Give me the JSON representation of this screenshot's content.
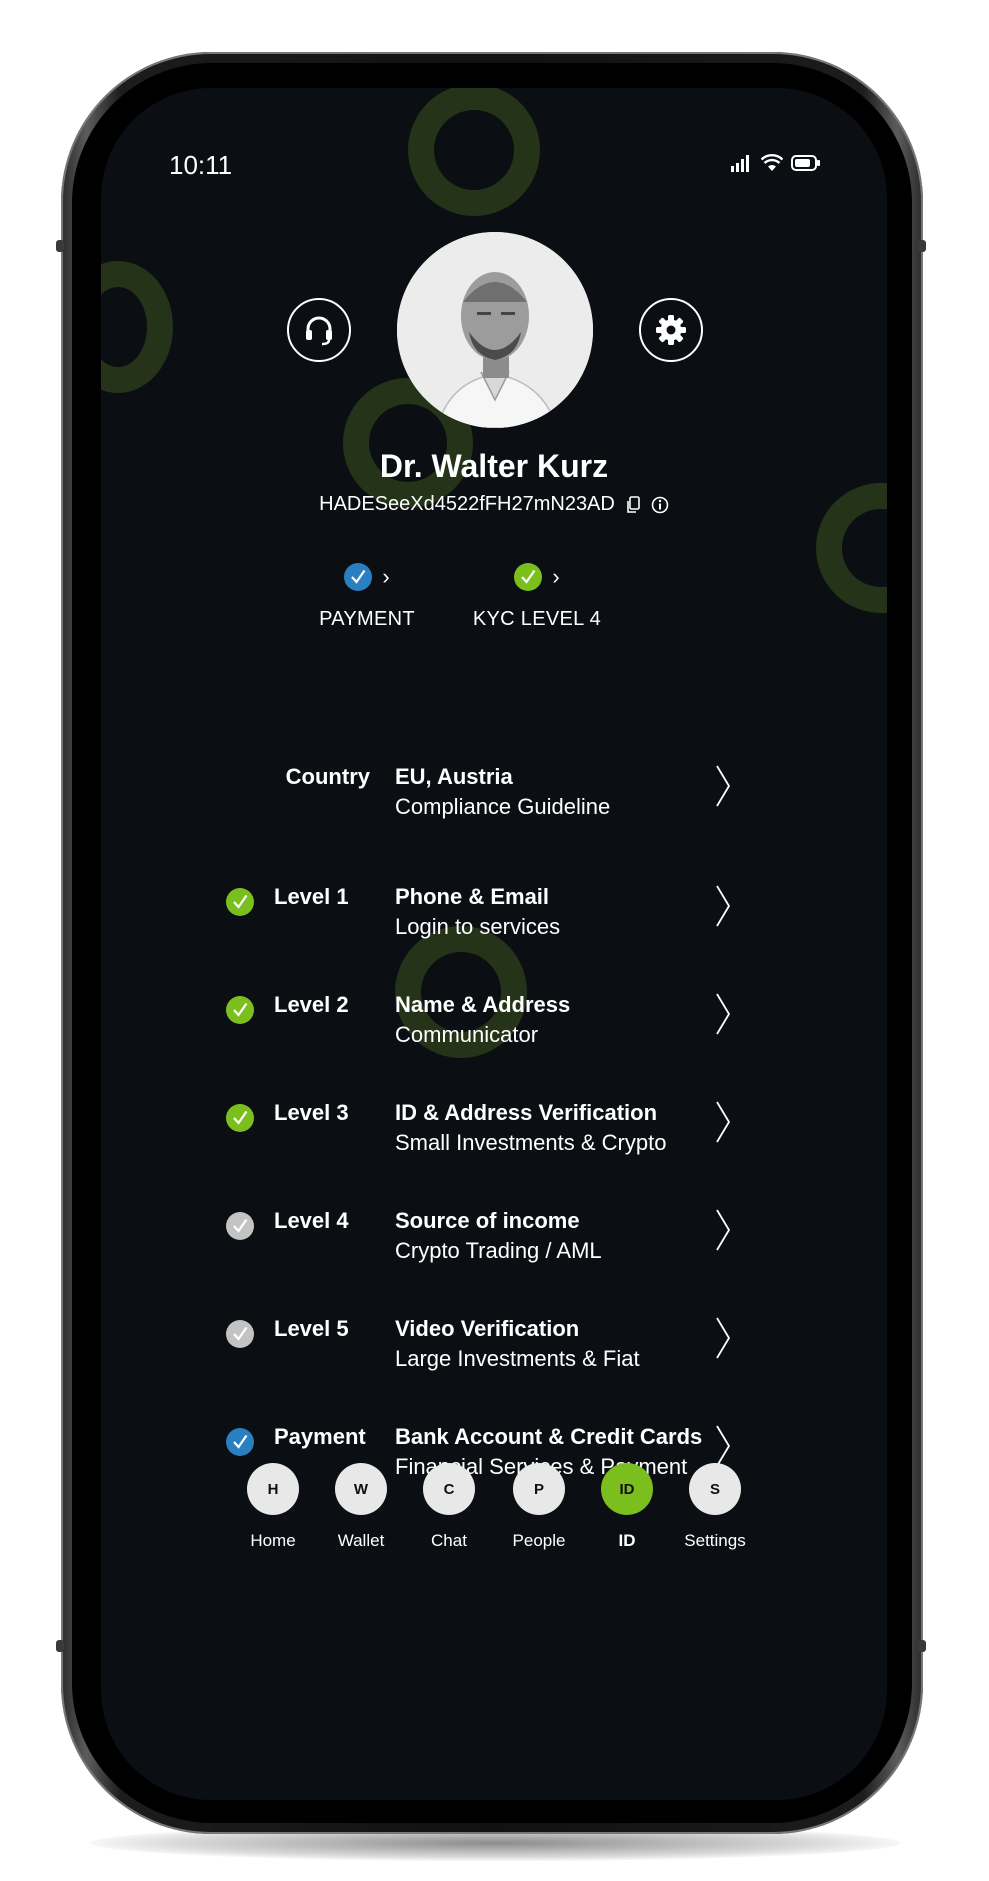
{
  "status_bar": {
    "time": "10:11",
    "icons": [
      "signal-icon",
      "wifi-icon",
      "battery-icon"
    ]
  },
  "header": {
    "support_icon": "headset-icon",
    "settings_icon": "gear-icon",
    "user_name": "Dr. Walter Kurz",
    "user_id": "HADESeeXd4522fFH27mN23AD",
    "id_icons": [
      "copy-icon",
      "info-icon"
    ]
  },
  "badges": [
    {
      "label": "PAYMENT",
      "status": "blue"
    },
    {
      "label": "KYC LEVEL 4",
      "status": "green"
    }
  ],
  "rows": [
    {
      "label": "Country",
      "title": "EU, Austria",
      "subtitle": "Compliance Guideline",
      "status": "none"
    },
    {
      "label": "Level 1",
      "title": "Phone & Email",
      "subtitle": "Login to services",
      "status": "green"
    },
    {
      "label": "Level 2",
      "title": "Name & Address",
      "subtitle": "Communicator",
      "status": "green"
    },
    {
      "label": "Level 3",
      "title": "ID & Address Verification",
      "subtitle": "Small Investments & Crypto",
      "status": "green"
    },
    {
      "label": "Level 4",
      "title": "Source of income",
      "subtitle": "Crypto Trading / AML",
      "status": "grey"
    },
    {
      "label": "Level 5",
      "title": "Video Verification",
      "subtitle": "Large Investments & Fiat",
      "status": "grey"
    },
    {
      "label": "Payment",
      "title": "Bank Account & Credit Cards",
      "subtitle": "Financial Services & Payment",
      "status": "blue"
    }
  ],
  "nav": [
    {
      "letter": "H",
      "label": "Home",
      "active": false
    },
    {
      "letter": "W",
      "label": "Wallet",
      "active": false
    },
    {
      "letter": "C",
      "label": "Chat",
      "active": false
    },
    {
      "letter": "P",
      "label": "People",
      "active": false
    },
    {
      "letter": "ID",
      "label": "ID",
      "active": true
    },
    {
      "letter": "S",
      "label": "Settings",
      "active": false
    }
  ],
  "colors": {
    "screen_bg": "#0b0e13",
    "accent_green": "#7bbf1e",
    "accent_blue": "#2a7fc0",
    "pending_grey": "#c3c3c3",
    "ring": "#2a3a1a"
  }
}
